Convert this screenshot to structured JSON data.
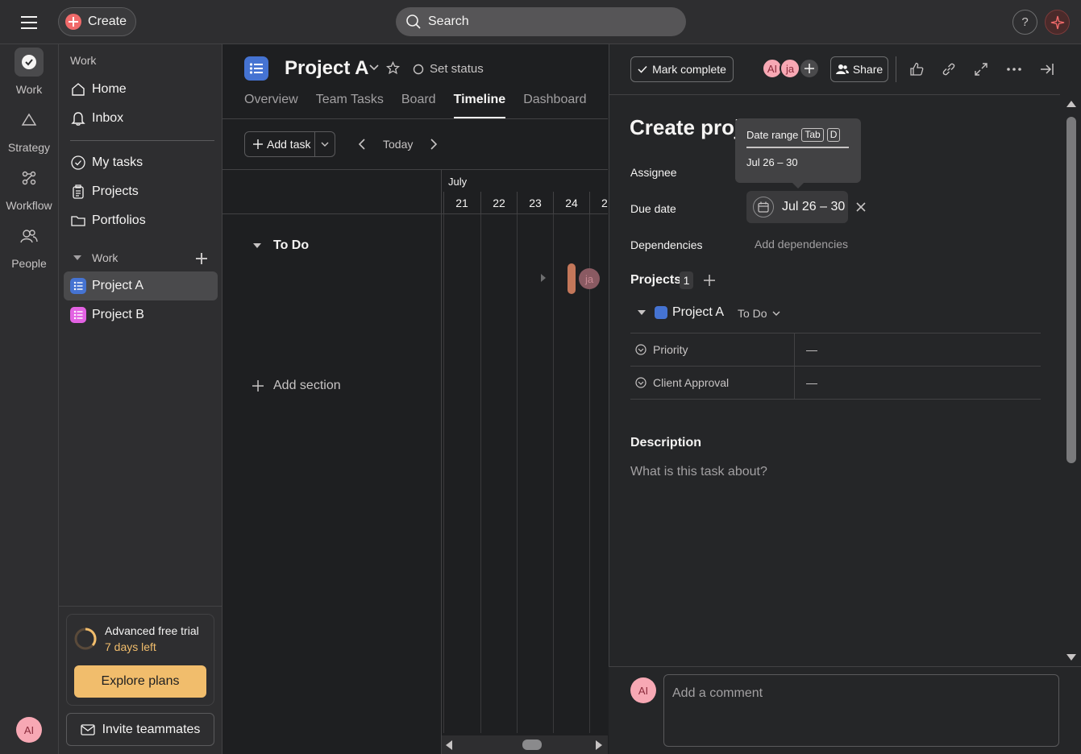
{
  "topbar": {
    "create_label": "Create",
    "search_placeholder": "Search",
    "help_label": "?"
  },
  "rail": {
    "items": [
      {
        "label": "Work",
        "icon": "check-circle-icon"
      },
      {
        "label": "Strategy",
        "icon": "triangle-icon"
      },
      {
        "label": "Workflow",
        "icon": "workflow-icon"
      },
      {
        "label": "People",
        "icon": "people-icon"
      }
    ],
    "user_initials": "AI"
  },
  "sidebar": {
    "heading": "Work",
    "nav": [
      {
        "label": "Home",
        "icon": "home-icon"
      },
      {
        "label": "Inbox",
        "icon": "bell-icon"
      }
    ],
    "nav2": [
      {
        "label": "My tasks",
        "icon": "check-circle-icon"
      },
      {
        "label": "Projects",
        "icon": "clipboard-icon"
      },
      {
        "label": "Portfolios",
        "icon": "folder-icon"
      }
    ],
    "section_label": "Work",
    "projects": [
      {
        "label": "Project A",
        "color": "#4573d2"
      },
      {
        "label": "Project B",
        "color": "#e362e3"
      }
    ],
    "trial_title": "Advanced free trial",
    "trial_days": "7 days left",
    "explore_label": "Explore plans",
    "invite_label": "Invite teammates"
  },
  "main": {
    "project_title": "Project A",
    "set_status": "Set status",
    "tabs": [
      "Overview",
      "Team Tasks",
      "Board",
      "Timeline",
      "Dashboard"
    ],
    "active_tab": "Timeline",
    "add_task": "Add task",
    "today": "Today",
    "month": "July",
    "days": [
      "21",
      "22",
      "23",
      "24",
      "2"
    ],
    "section_name": "To Do",
    "add_section": "Add section",
    "bar_avatar": "ja"
  },
  "panel": {
    "mark_complete": "Mark complete",
    "avatars": [
      "AI",
      "ja"
    ],
    "share": "Share",
    "task_title": "Create proj",
    "tooltip_title": "Date range",
    "tooltip_key1": "Tab",
    "tooltip_key2": "D",
    "tooltip_value": "Jul 26 – 30",
    "assignee_label": "Assignee",
    "due_date_label": "Due date",
    "due_date_value": "Jul 26 – 30",
    "dependencies_label": "Dependencies",
    "add_dependencies": "Add dependencies",
    "projects_label": "Projects",
    "projects_count": "1",
    "project_name": "Project A",
    "project_section": "To Do",
    "fields": [
      {
        "label": "Priority",
        "value": "—"
      },
      {
        "label": "Client Approval",
        "value": "—"
      }
    ],
    "description_label": "Description",
    "description_placeholder": "What is this task about?",
    "comment_avatar": "AI",
    "comment_placeholder": "Add a comment"
  }
}
